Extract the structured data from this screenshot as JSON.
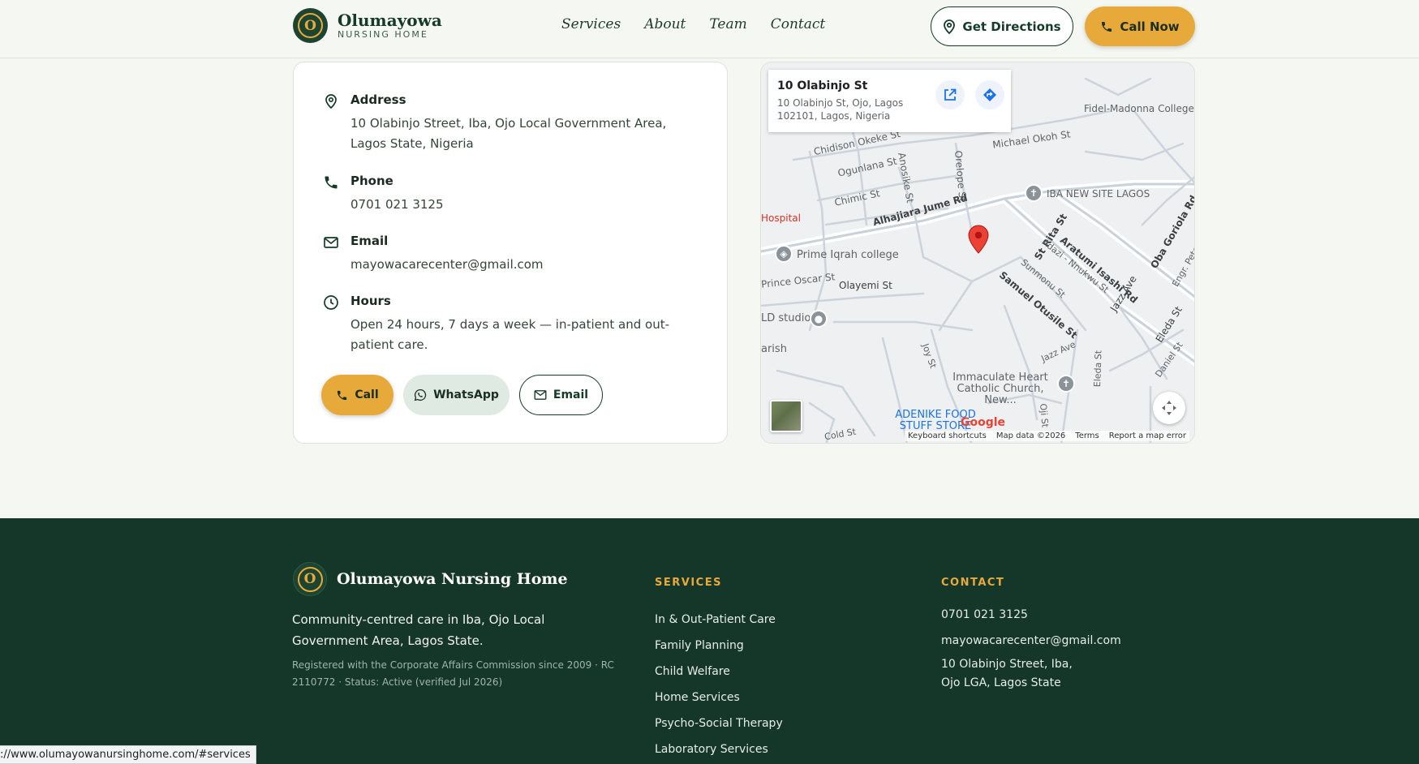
{
  "header": {
    "logo_name": "Olumayowa",
    "logo_sub": "NURSING HOME",
    "logo_mark": "O",
    "nav": [
      "Services",
      "About",
      "Team",
      "Contact"
    ],
    "directions_label": "Get Directions",
    "call_label": "Call Now"
  },
  "contact_card": {
    "address_label": "Address",
    "address_value": "10 Olabinjo Street, Iba, Ojo Local Government Area, Lagos State, Nigeria",
    "phone_label": "Phone",
    "phone_value": "0701 021 3125",
    "email_label": "Email",
    "email_value": "mayowacarecenter@gmail.com",
    "hours_label": "Hours",
    "hours_value": "Open 24 hours, 7 days a week — in-patient and out-patient care.",
    "call_btn": "Call",
    "whatsapp_btn": "WhatsApp",
    "email_btn": "Email"
  },
  "map": {
    "place_title": "10 Olabinjo St",
    "place_address": "10 Olabinjo St, Ojo, Lagos 102101, Lagos, Nigeria",
    "labels": {
      "fidel": "Fidel-Madonna College Of Excellence",
      "michael": "Michael Okoh St",
      "chidison": "Chidison Okeke St",
      "ogunlana": "Ogunlana St",
      "chimic": "Chimic St",
      "anosike": "Anosike St",
      "orelope": "Orelope St",
      "iba_new_site": "IBA NEW SITE LAGOS",
      "hospital": "Hospital",
      "alhajiara": "Alhajiara Jume Rd",
      "st_rita": "St Rita St",
      "aratumi": "Aratumi Isashi Rd",
      "oba_goriola": "Oba Goriola Rd",
      "adazi": "Adazi - Nnukwu St",
      "prime_iqrah": "Prime Iqrah college",
      "sunmonu": "Sunmonu St",
      "engr_peter": "Engr. Pete",
      "prince_oscar": "Prince Oscar St",
      "olayemi": "Olayemi St",
      "samuel_otusile": "Samuel Otusile St",
      "jazz_ave": "Jazz Ave",
      "eleda": "Eleda St",
      "ld_studio": "LD studio",
      "parish": "arish",
      "joy": "Joy St",
      "jazz_ave2": "Jazz Ave",
      "daniel": "Daniel St",
      "immaculate": "Immaculate Heart Catholic Church, New...",
      "adenike": "ADENIKE FOOD STUFF STORE",
      "oji": "Oji St",
      "eleda2": "Eleda St",
      "cold": "Cold St",
      "google": "Google"
    },
    "attribution": [
      "Keyboard shortcuts",
      "Map data ©2026",
      "Terms",
      "Report a map error"
    ]
  },
  "footer": {
    "name": "Olumayowa Nursing Home",
    "logo_mark": "O",
    "description": "Community-centred care in Iba, Ojo Local Government Area, Lagos State.",
    "registration": "Registered with the Corporate Affairs Commission since 2009 · RC 2110772 · Status: Active (verified Jul 2026)",
    "services_heading": "SERVICES",
    "services": [
      "In & Out-Patient Care",
      "Family Planning",
      "Child Welfare",
      "Home Services",
      "Psycho-Social Therapy",
      "Laboratory Services"
    ],
    "contact_heading": "CONTACT",
    "contact_phone": "0701 021 3125",
    "contact_email": "mayowacarecenter@gmail.com",
    "contact_address_1": "10 Olabinjo Street, Iba,",
    "contact_address_2": "Ojo LGA, Lagos State"
  },
  "status_bar": {
    "url": "://www.olumayowanursinghome.com/#services"
  },
  "colors": {
    "brand_green": "#163a28",
    "accent_gold": "#e8a93b",
    "footer_bg": "#15372a"
  }
}
